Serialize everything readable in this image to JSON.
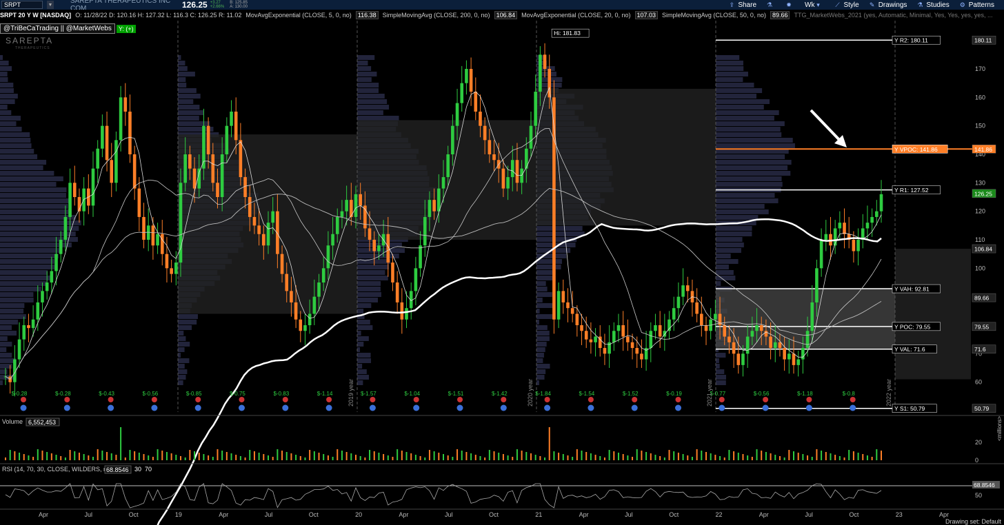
{
  "header": {
    "symbol": "SRPT",
    "company": "SAREPTA THERAPEUTICS INC COM",
    "last": "126.25",
    "change": "+3.27",
    "change_pct": "+2.66%",
    "bid": "B: 125.85",
    "ask": "A: 130.00",
    "menu": [
      {
        "name": "share",
        "label": "Share",
        "icon": "share-icon"
      },
      {
        "name": "flask",
        "label": "",
        "icon": "flask-icon"
      },
      {
        "name": "gear",
        "label": "",
        "icon": "gear-icon"
      },
      {
        "name": "wk",
        "label": "Wk",
        "icon": "chevron-down-icon"
      },
      {
        "name": "style",
        "label": "Style",
        "icon": "style-icon"
      },
      {
        "name": "drawings",
        "label": "Drawings",
        "icon": "pencil-icon"
      },
      {
        "name": "studies",
        "label": "Studies",
        "icon": "flask-icon"
      },
      {
        "name": "patterns",
        "label": "Patterns",
        "icon": "patterns-icon"
      }
    ]
  },
  "studybar": {
    "title": "SRPT 20 Y W [NASDAQ]",
    "ohlc": "O: 11/28/22  D: 120.16  H: 127.32  L: 116.3  C: 126.25  R: 11.02",
    "studies": [
      {
        "label": "MovAvgExponential (CLOSE, 5, 0, no)",
        "value": "116.38"
      },
      {
        "label": "SimpleMovingAvg (CLOSE, 200, 0, no)",
        "value": "106.84"
      },
      {
        "label": "MovAvgExponential (CLOSE, 20, 0, no)",
        "value": "107.03"
      },
      {
        "label": "SimpleMovingAvg (CLOSE, 50, 0, no)",
        "value": "89.66"
      }
    ],
    "tail": "TTG_MarketWebs_2021 (yes, Automatic, Minimal, Yes, Yes, yes, yes, ..."
  },
  "tag": {
    "handles": "@TriBeCaTrading || @MarketWebs",
    "y": "Y: (+)"
  },
  "logo": {
    "name": "SAREPTA",
    "sub": "THERAPEUTICS"
  },
  "volume_label": "Volume",
  "volume_value": "6,552,453",
  "rsi_label": "RSI (14, 70, 30, CLOSE, WILDERS, no)",
  "rsi_value": "68.8546",
  "rsi_levels": [
    "30",
    "70"
  ],
  "volume_unit": "<millions>",
  "footer": "Drawing set: Default",
  "colors": {
    "up": "#2ecc40",
    "down": "#ff7f27",
    "vpoc": "#ff7f27",
    "ma": "#ffffff"
  },
  "chart_data": {
    "type": "candlestick",
    "title": "SRPT 20 Y W [NASDAQ]",
    "y_range": [
      50,
      185
    ],
    "y_ticks": [
      60,
      70,
      80,
      90,
      100,
      110,
      120,
      130,
      140,
      150,
      160,
      170,
      180
    ],
    "price_labels": [
      {
        "text": "180.11",
        "value": 180.11
      },
      {
        "text": "141.86",
        "value": 141.86
      },
      {
        "text": "126.25",
        "value": 126.25
      },
      {
        "text": "106.84",
        "value": 106.84
      },
      {
        "text": "89.66",
        "value": 89.66
      },
      {
        "text": "79.55",
        "value": 79.55
      },
      {
        "text": "71.6",
        "value": 71.6
      },
      {
        "text": "50.79",
        "value": 50.79
      }
    ],
    "x_labels": [
      "Apr",
      "Jul",
      "Oct",
      "19",
      "Apr",
      "Jul",
      "Oct",
      "20",
      "Apr",
      "Jul",
      "Oct",
      "21",
      "Apr",
      "Jul",
      "Oct",
      "22",
      "Apr",
      "Jul",
      "Oct",
      "23",
      "Apr"
    ],
    "year_labels": [
      "2019 year",
      "2020 year",
      "2021 year",
      "2022 year"
    ],
    "hi_label": "Hi: 181.83",
    "earnings": [
      "$-0.28",
      "$-0.28",
      "$-0.43",
      "$-0.56",
      "$-0.85",
      "$-0.75",
      "$-0.83",
      "$-1.14",
      "$-1.57",
      "$-1.04",
      "$-1.51",
      "$-1.42",
      "$-1.84",
      "$-1.54",
      "$-1.52",
      "$-0.19",
      "$-0.77",
      "$-0.56",
      "$-1.18",
      "$-0.8"
    ],
    "levels": [
      {
        "text": "Y R2: 180.11",
        "value": 180.11
      },
      {
        "text": "Y VPOC: 141.86",
        "value": 141.86
      },
      {
        "text": "Y R1: 127.52",
        "value": 127.52
      },
      {
        "text": "Y VAH: 92.81",
        "value": 92.81
      },
      {
        "text": "Y POC: 79.55",
        "value": 79.55
      },
      {
        "text": "Y VAL: 71.6",
        "value": 71.6
      },
      {
        "text": "Y S1: 50.79",
        "value": 50.79
      }
    ],
    "volume_ticks": [
      "20",
      "0"
    ],
    "rsi_ticks": [
      "70",
      "50"
    ],
    "closes": [
      62,
      60,
      68,
      75,
      80,
      79,
      82,
      88,
      92,
      95,
      99,
      105,
      110,
      118,
      130,
      125,
      120,
      128,
      122,
      135,
      142,
      150,
      138,
      130,
      145,
      160,
      155,
      140,
      128,
      118,
      110,
      115,
      108,
      112,
      105,
      100,
      98,
      102,
      130,
      140,
      135,
      128,
      135,
      150,
      140,
      130,
      125,
      140,
      150,
      155,
      145,
      132,
      125,
      118,
      115,
      112,
      108,
      116,
      120,
      105,
      98,
      92,
      88,
      82,
      78,
      80,
      84,
      90,
      95,
      100,
      108,
      112,
      118,
      120,
      124,
      118,
      126,
      122,
      114,
      110,
      106,
      108,
      112,
      102,
      95,
      88,
      82,
      86,
      92,
      100,
      108,
      118,
      124,
      120,
      128,
      132,
      140,
      150,
      158,
      165,
      170,
      162,
      155,
      150,
      145,
      140,
      138,
      135,
      128,
      132,
      138,
      130,
      135,
      142,
      150,
      162,
      175,
      170,
      160,
      82,
      92,
      88,
      86,
      84,
      80,
      78,
      75,
      74,
      76,
      72,
      70,
      74,
      78,
      80,
      76,
      74,
      72,
      70,
      68,
      72,
      78,
      80,
      76,
      78,
      82,
      86,
      90,
      94,
      92,
      88,
      84,
      80,
      78,
      82,
      84,
      80,
      76,
      74,
      70,
      66,
      70,
      76,
      78,
      80,
      78,
      76,
      72,
      74,
      72,
      68,
      70,
      66,
      68,
      72,
      78,
      88,
      100,
      110,
      112,
      108,
      114,
      116,
      112,
      110,
      106,
      110,
      114,
      116,
      118,
      120,
      126
    ]
  }
}
